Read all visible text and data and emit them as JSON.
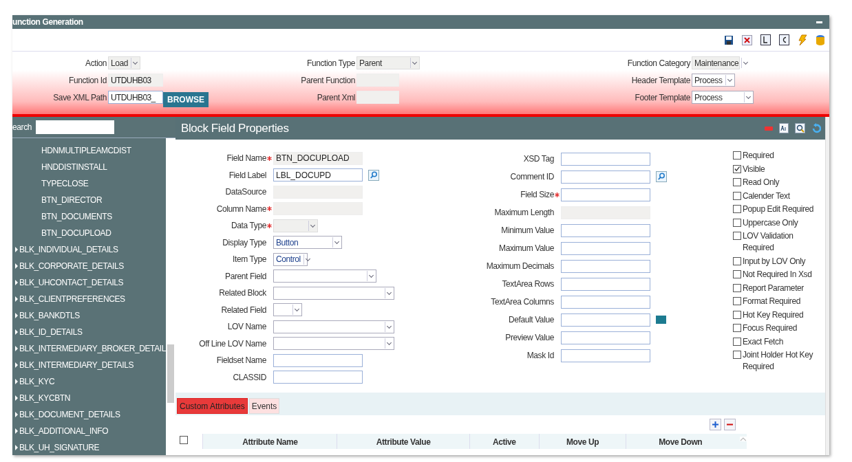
{
  "window": {
    "title": "unction Generation"
  },
  "header": {
    "col1": [
      {
        "label": "Action",
        "kind": "select",
        "value": "Load",
        "disabled": true
      },
      {
        "label": "Function Id",
        "kind": "text",
        "value": "UTDUHB03",
        "disabled": true
      },
      {
        "label": "Save XML Path",
        "kind": "browse",
        "value": "UTDUHB03_",
        "button": "BROWSE",
        "disabled": false
      }
    ],
    "col2": [
      {
        "label": "Function Type",
        "kind": "select",
        "value": "Parent",
        "disabled": true
      },
      {
        "label": "Parent Function",
        "kind": "text",
        "disabled": true
      },
      {
        "label": "Parent Xml",
        "kind": "text",
        "disabled": true
      }
    ],
    "col3": [
      {
        "label": "Function Category",
        "kind": "select",
        "value": "Maintenance",
        "disabled": true
      },
      {
        "label": "Header Template",
        "kind": "select",
        "value": "Process",
        "disabled": false
      },
      {
        "label": "Footer Template",
        "kind": "select",
        "value": "Process",
        "disabled": false
      }
    ]
  },
  "sidebar": {
    "search_label": "earch",
    "items": [
      {
        "label": "HDNMULTIPLEAMCDIST",
        "kind": "leaf"
      },
      {
        "label": "HNDDISTINSTALL",
        "kind": "leaf"
      },
      {
        "label": "TYPECLOSE",
        "kind": "leaf"
      },
      {
        "label": "BTN_DIRECTOR",
        "kind": "leaf"
      },
      {
        "label": "BTN_DOCUMENTS",
        "kind": "leaf"
      },
      {
        "label": "BTN_DOCUPLOAD",
        "kind": "leaf"
      },
      {
        "label": "BLK_INDIVIDUAL_DETAILS",
        "kind": "block",
        "expanded": false
      },
      {
        "label": "BLK_CORPORATE_DETAILS",
        "kind": "block",
        "expanded": false
      },
      {
        "label": "BLK_UHCONTACT_DETAILS",
        "kind": "block",
        "expanded": false
      },
      {
        "label": "BLK_CLIENTPREFERENCES",
        "kind": "block",
        "expanded": false
      },
      {
        "label": "BLK_BANKDTLS",
        "kind": "block",
        "expanded": false
      },
      {
        "label": "BLK_ID_DETAILS",
        "kind": "block",
        "expanded": false
      },
      {
        "label": "BLK_INTERMEDIARY_BROKER_DETAIL",
        "kind": "block",
        "expanded": false
      },
      {
        "label": "BLK_INTERMEDIARY_DETAILS",
        "kind": "block",
        "expanded": false
      },
      {
        "label": "BLK_KYC",
        "kind": "block",
        "expanded": false
      },
      {
        "label": "BLK_KYCBTN",
        "kind": "block",
        "expanded": false
      },
      {
        "label": "BLK_DOCUMENT_DETAILS",
        "kind": "block",
        "expanded": false
      },
      {
        "label": "BLK_ADDITIONAL_INFO",
        "kind": "block",
        "expanded": false
      },
      {
        "label": "BLK_UH_SIGNATURE",
        "kind": "block",
        "expanded": false
      }
    ]
  },
  "panel": {
    "title": "Block Field Properties",
    "left_fields": [
      {
        "label": "Field Name",
        "required": true,
        "kind": "text",
        "value": "BTN_DOCUPLOAD",
        "disabled": true
      },
      {
        "label": "Field Label",
        "required": false,
        "kind": "lookup",
        "value": "LBL_DOCUPD",
        "disabled": false
      },
      {
        "label": "DataSource",
        "required": false,
        "kind": "text",
        "disabled": true
      },
      {
        "label": "Column Name",
        "required": true,
        "kind": "text",
        "disabled": true
      },
      {
        "label": "Data Type",
        "required": true,
        "kind": "select",
        "disabled": true
      },
      {
        "label": "Display Type",
        "required": false,
        "kind": "select",
        "value": "Button",
        "disabled": false
      },
      {
        "label": "Item Type",
        "required": false,
        "kind": "select",
        "value": "Control",
        "disabled": false
      },
      {
        "label": "Parent Field",
        "required": false,
        "kind": "select",
        "disabled": false
      },
      {
        "label": "Related Block",
        "required": false,
        "kind": "select",
        "disabled": false
      },
      {
        "label": "Related Field",
        "required": false,
        "kind": "select",
        "disabled": false
      },
      {
        "label": "LOV Name",
        "required": false,
        "kind": "select",
        "disabled": false
      },
      {
        "label": "Off Line LOV Name",
        "required": false,
        "kind": "select",
        "disabled": false
      },
      {
        "label": "Fieldset Name",
        "required": false,
        "kind": "text",
        "disabled": false
      },
      {
        "label": "CLASSID",
        "required": false,
        "kind": "text",
        "disabled": false
      }
    ],
    "right_fields": [
      {
        "label": "XSD Tag",
        "required": false,
        "kind": "text",
        "disabled": false
      },
      {
        "label": "Comment ID",
        "required": false,
        "kind": "lookup",
        "disabled": false
      },
      {
        "label": "Field Size",
        "required": true,
        "kind": "text",
        "disabled": false
      },
      {
        "label": "Maximum Length",
        "required": false,
        "kind": "text",
        "disabled": true
      },
      {
        "label": "Minimum Value",
        "required": false,
        "kind": "text",
        "disabled": false
      },
      {
        "label": "Maximum Value",
        "required": false,
        "kind": "text",
        "disabled": false
      },
      {
        "label": "Maximum Decimals",
        "required": false,
        "kind": "text",
        "disabled": false
      },
      {
        "label": "TextArea Rows",
        "required": false,
        "kind": "text",
        "disabled": false
      },
      {
        "label": "TextArea Columns",
        "required": false,
        "kind": "text",
        "disabled": false
      },
      {
        "label": "Default Value",
        "required": false,
        "kind": "color",
        "disabled": false
      },
      {
        "label": "Preview Value",
        "required": false,
        "kind": "text",
        "disabled": false
      },
      {
        "label": "Mask Id",
        "required": false,
        "kind": "text",
        "disabled": false
      }
    ],
    "checkboxes": [
      {
        "label": "Required",
        "checked": false
      },
      {
        "label": "Visible",
        "checked": true
      },
      {
        "label": "Read Only",
        "checked": false
      },
      {
        "label": "Calender Text",
        "checked": false
      },
      {
        "label": "Popup Edit Required",
        "checked": false
      },
      {
        "label": "Uppercase Only",
        "checked": false
      },
      {
        "label": "LOV Validation Required",
        "checked": false
      },
      {
        "label": "Input by LOV Only",
        "checked": false
      },
      {
        "label": "Not Required In Xsd",
        "checked": false
      },
      {
        "label": "Report Parameter",
        "checked": false
      },
      {
        "label": "Format Required",
        "checked": false
      },
      {
        "label": "Hot Key Required",
        "checked": false
      },
      {
        "label": "Focus Required",
        "checked": false
      },
      {
        "label": "Exact Fetch",
        "checked": false
      },
      {
        "label": "Joint Holder Hot Key Required",
        "checked": false
      }
    ],
    "tabs": [
      {
        "label": "Custom Attributes",
        "selected": true
      },
      {
        "label": "Events",
        "selected": false
      }
    ],
    "table": {
      "columns": [
        "Attribute Name",
        "Attribute Value",
        "Active",
        "Move Up",
        "Move Down"
      ],
      "select_all_checked": false
    }
  }
}
